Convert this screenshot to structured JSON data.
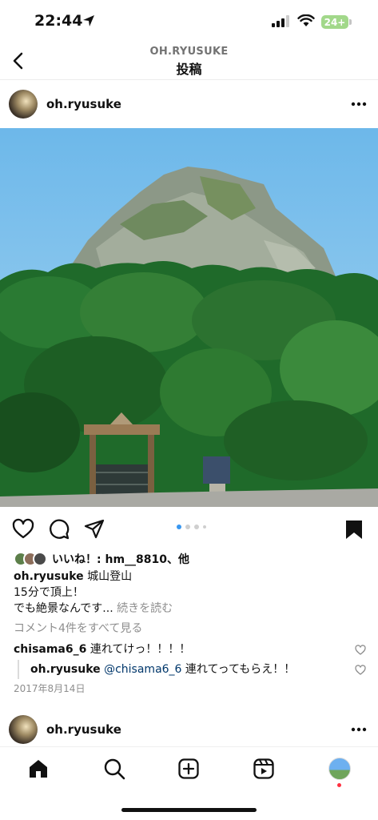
{
  "status_bar": {
    "time": "22:44",
    "battery": "24+",
    "icons": [
      "location-arrow-icon",
      "signal-icon",
      "wifi-icon",
      "battery-icon"
    ]
  },
  "header": {
    "username": "OH.RYUSUKE",
    "title": "投稿",
    "back_icon": "chevron-left-icon"
  },
  "post": {
    "username": "oh.ryusuke",
    "image_description_icon": "photo",
    "carousel": {
      "count": 4,
      "current": 1
    },
    "likes_text": "いいね！: hm__8810、他",
    "caption_user": "oh.ryusuke",
    "caption_line1": "城山登山",
    "caption_line2": "15分で頂上！",
    "caption_line3": "でも絶景なんです...",
    "read_more": "続きを読む",
    "view_comments": "コメント4件をすべて見る",
    "comments": [
      {
        "user": "chisama6_6",
        "text": "連れてけっ！！！！"
      },
      {
        "user": "oh.ryusuke",
        "mention": "@chisama6_6",
        "text": "連れてってもらえ！！"
      }
    ],
    "date": "2017年8月14日"
  },
  "next_post": {
    "username": "oh.ryusuke"
  },
  "tabbar": {
    "items": [
      "home-icon",
      "search-icon",
      "create-icon",
      "reels-icon",
      "profile-avatar"
    ]
  },
  "colors": {
    "accent": "#3897f0",
    "notification": "#ff3040",
    "battery": "#a2d88a"
  }
}
